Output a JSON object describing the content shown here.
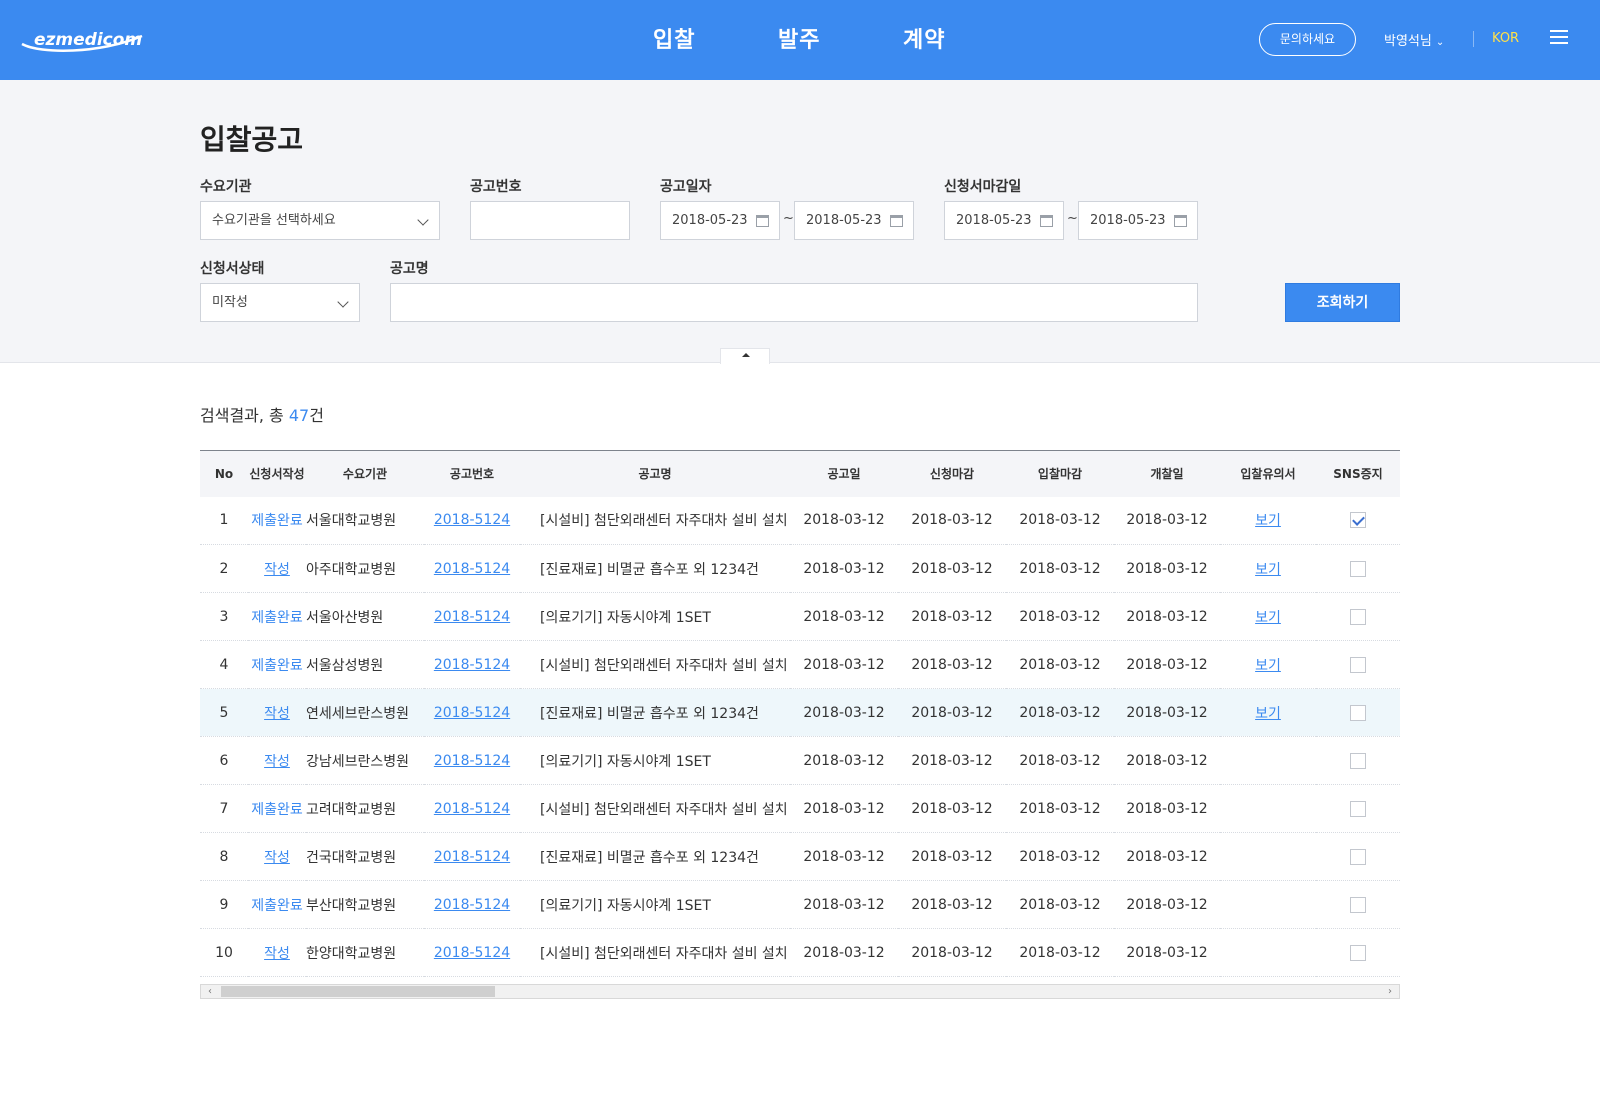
{
  "header": {
    "logo_text": "ezmedicom",
    "nav": [
      "입찰",
      "발주",
      "계약"
    ],
    "contact_label": "문의하세요",
    "user_name": "박영석님",
    "lang_label": "KOR"
  },
  "search": {
    "page_title": "입찰공고",
    "agency_label": "수요기관",
    "agency_value": "수요기관을 선택하세요",
    "notice_no_label": "공고번호",
    "notice_no_value": "",
    "notice_date_label": "공고일자",
    "notice_date_from": "2018-05-23",
    "notice_date_to": "2018-05-23",
    "deadline_label": "신청서마감일",
    "deadline_from": "2018-05-23",
    "deadline_to": "2018-05-23",
    "tilde": "~",
    "status_label": "신청서상태",
    "status_value": "미작성",
    "title_label": "공고명",
    "title_value": "",
    "search_button": "조회하기"
  },
  "results": {
    "count_prefix": "검색결과, 총 ",
    "count": "47",
    "count_suffix": "건"
  },
  "table": {
    "headers": [
      "No",
      "신청서작성",
      "수요기관",
      "공고번호",
      "공고명",
      "공고일",
      "신청마감",
      "입찰마감",
      "개찰일",
      "입찰유의서",
      "SNS증지"
    ],
    "rows": [
      {
        "no": "1",
        "status": "제출완료",
        "agency": "서울대학교병원",
        "notice_no": "2018-5124",
        "title": "[시설비] 첨단외래센터 자주대차 설비 설치",
        "notice_date": "2018-03-12",
        "apply_deadline": "2018-03-12",
        "bid_deadline": "2018-03-12",
        "open_date": "2018-03-12",
        "notice_doc": "보기",
        "sns": true
      },
      {
        "no": "2",
        "status": "작성",
        "agency": "아주대학교병원",
        "notice_no": "2018-5124",
        "title": "[진료재료] 비멸균 흡수포 외 1234건",
        "notice_date": "2018-03-12",
        "apply_deadline": "2018-03-12",
        "bid_deadline": "2018-03-12",
        "open_date": "2018-03-12",
        "notice_doc": "보기",
        "sns": false
      },
      {
        "no": "3",
        "status": "제출완료",
        "agency": "서울아산병원",
        "notice_no": "2018-5124",
        "title": "[의료기기] 자동시야계 1SET",
        "notice_date": "2018-03-12",
        "apply_deadline": "2018-03-12",
        "bid_deadline": "2018-03-12",
        "open_date": "2018-03-12",
        "notice_doc": "보기",
        "sns": false
      },
      {
        "no": "4",
        "status": "제출완료",
        "agency": "서울삼성병원",
        "notice_no": "2018-5124",
        "title": "[시설비] 첨단외래센터 자주대차 설비 설치",
        "notice_date": "2018-03-12",
        "apply_deadline": "2018-03-12",
        "bid_deadline": "2018-03-12",
        "open_date": "2018-03-12",
        "notice_doc": "보기",
        "sns": false
      },
      {
        "no": "5",
        "status": "작성",
        "agency": "연세세브란스병원",
        "notice_no": "2018-5124",
        "title": "[진료재료] 비멸균 흡수포 외 1234건",
        "notice_date": "2018-03-12",
        "apply_deadline": "2018-03-12",
        "bid_deadline": "2018-03-12",
        "open_date": "2018-03-12",
        "notice_doc": "보기",
        "sns": false,
        "highlight": true
      },
      {
        "no": "6",
        "status": "작성",
        "agency": "강남세브란스병원",
        "notice_no": "2018-5124",
        "title": "[의료기기] 자동시야계 1SET",
        "notice_date": "2018-03-12",
        "apply_deadline": "2018-03-12",
        "bid_deadline": "2018-03-12",
        "open_date": "2018-03-12",
        "notice_doc": "",
        "sns": false
      },
      {
        "no": "7",
        "status": "제출완료",
        "agency": "고려대학교병원",
        "notice_no": "2018-5124",
        "title": "[시설비] 첨단외래센터 자주대차 설비 설치",
        "notice_date": "2018-03-12",
        "apply_deadline": "2018-03-12",
        "bid_deadline": "2018-03-12",
        "open_date": "2018-03-12",
        "notice_doc": "",
        "sns": false
      },
      {
        "no": "8",
        "status": "작성",
        "agency": "건국대학교병원",
        "notice_no": "2018-5124",
        "title": "[진료재료] 비멸균 흡수포 외 1234건",
        "notice_date": "2018-03-12",
        "apply_deadline": "2018-03-12",
        "bid_deadline": "2018-03-12",
        "open_date": "2018-03-12",
        "notice_doc": "",
        "sns": false
      },
      {
        "no": "9",
        "status": "제출완료",
        "agency": "부산대학교병원",
        "notice_no": "2018-5124",
        "title": "[의료기기] 자동시야계 1SET",
        "notice_date": "2018-03-12",
        "apply_deadline": "2018-03-12",
        "bid_deadline": "2018-03-12",
        "open_date": "2018-03-12",
        "notice_doc": "",
        "sns": false
      },
      {
        "no": "10",
        "status": "작성",
        "agency": "한양대학교병원",
        "notice_no": "2018-5124",
        "title": "[시설비] 첨단외래센터 자주대차 설비 설치",
        "notice_date": "2018-03-12",
        "apply_deadline": "2018-03-12",
        "bid_deadline": "2018-03-12",
        "open_date": "2018-03-12",
        "notice_doc": "",
        "sns": false
      }
    ]
  },
  "icons": {
    "calendar": "calendar-icon",
    "dropdown": "chevron-down-icon",
    "menu": "hamburger-icon",
    "collapse": "caret-up-icon",
    "check": "check-icon"
  },
  "colors": {
    "brand": "#3b8af0",
    "lang": "#ffe04a",
    "link": "#3b8af0",
    "highlight_row": "#eef7fb"
  }
}
